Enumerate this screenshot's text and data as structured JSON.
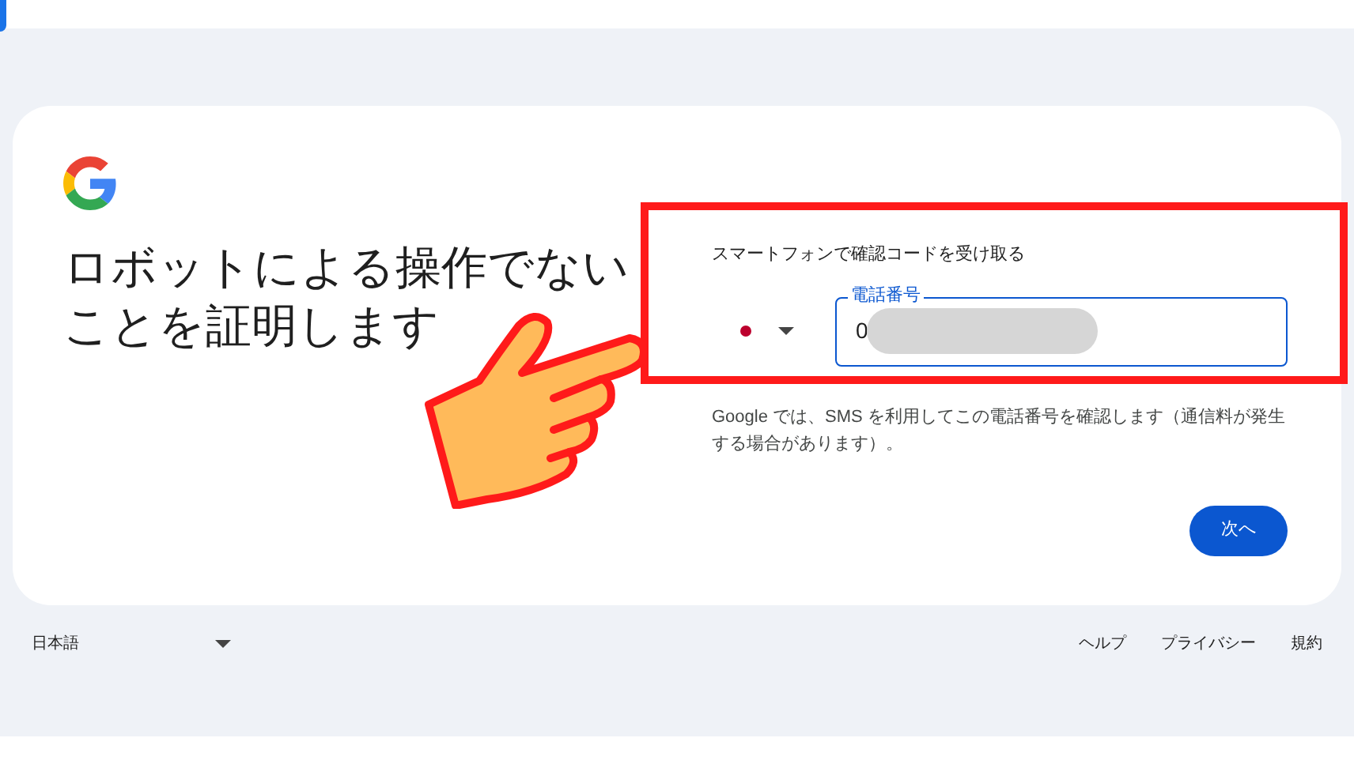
{
  "card": {
    "heading": "ロボットによる操作でないことを証明します",
    "prompt": "スマートフォンで確認コードを受け取る",
    "phone_field": {
      "label": "電話番号",
      "value": "0"
    },
    "note": "Google では、SMS を利用してこの電話番号を確認します（通信料が発生する場合があります）。",
    "next_button": "次へ"
  },
  "footer": {
    "language": "日本語",
    "links": [
      "ヘルプ",
      "プライバシー",
      "規約"
    ]
  }
}
